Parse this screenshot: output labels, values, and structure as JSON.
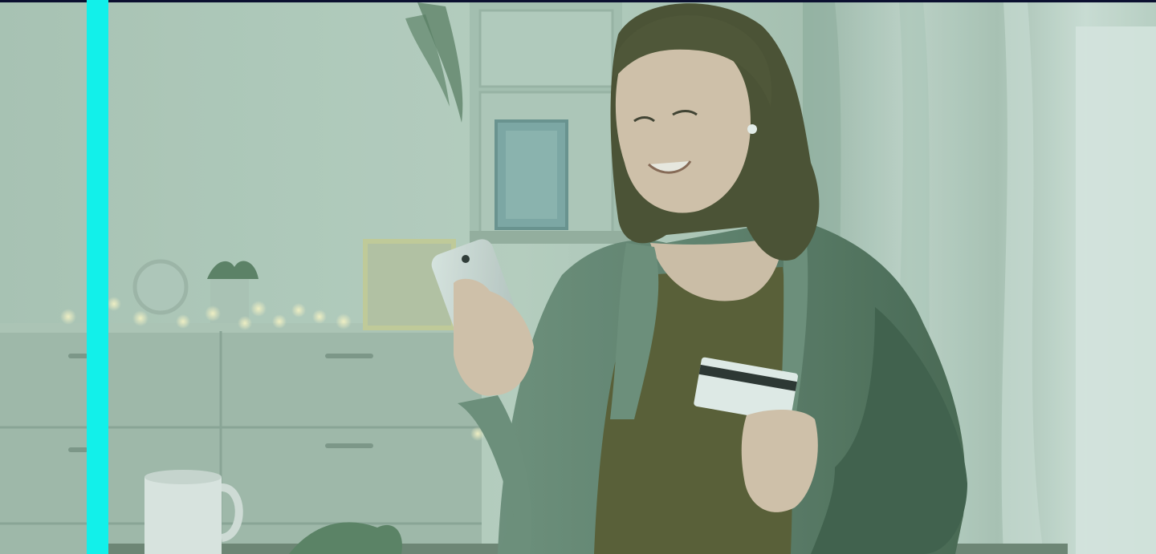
{
  "hero": {
    "description_hidden": "",
    "colors": {
      "accent_bar": "#12f0ea",
      "top_rule": "#0b1030",
      "wall": "#b9cdbf",
      "wall_shadow": "#9db5a6",
      "dresser": "#a8bdaf",
      "dresser_dark": "#8fa799",
      "desk": "#6b7f70",
      "shirt": "#5d7a68",
      "shirt_dark": "#4a6655",
      "tee": "#5b5a32",
      "skin": "#d9c3ad",
      "hair": "#4a4a2e",
      "phone": "#c9d2cf",
      "card": "#e9eeec",
      "card_stripe": "#2a2e2c",
      "curtain": "#c7d6cd",
      "window_light": "#dfe8e3",
      "mug": "#e3e8e5",
      "fairy_light": "#f3e4a8",
      "plant": "#4f6e55"
    },
    "icons": {
      "photo": "woman-with-phone-and-card-photo",
      "mug": "mug-icon",
      "phone": "smartphone-icon",
      "card": "credit-card-icon"
    }
  }
}
